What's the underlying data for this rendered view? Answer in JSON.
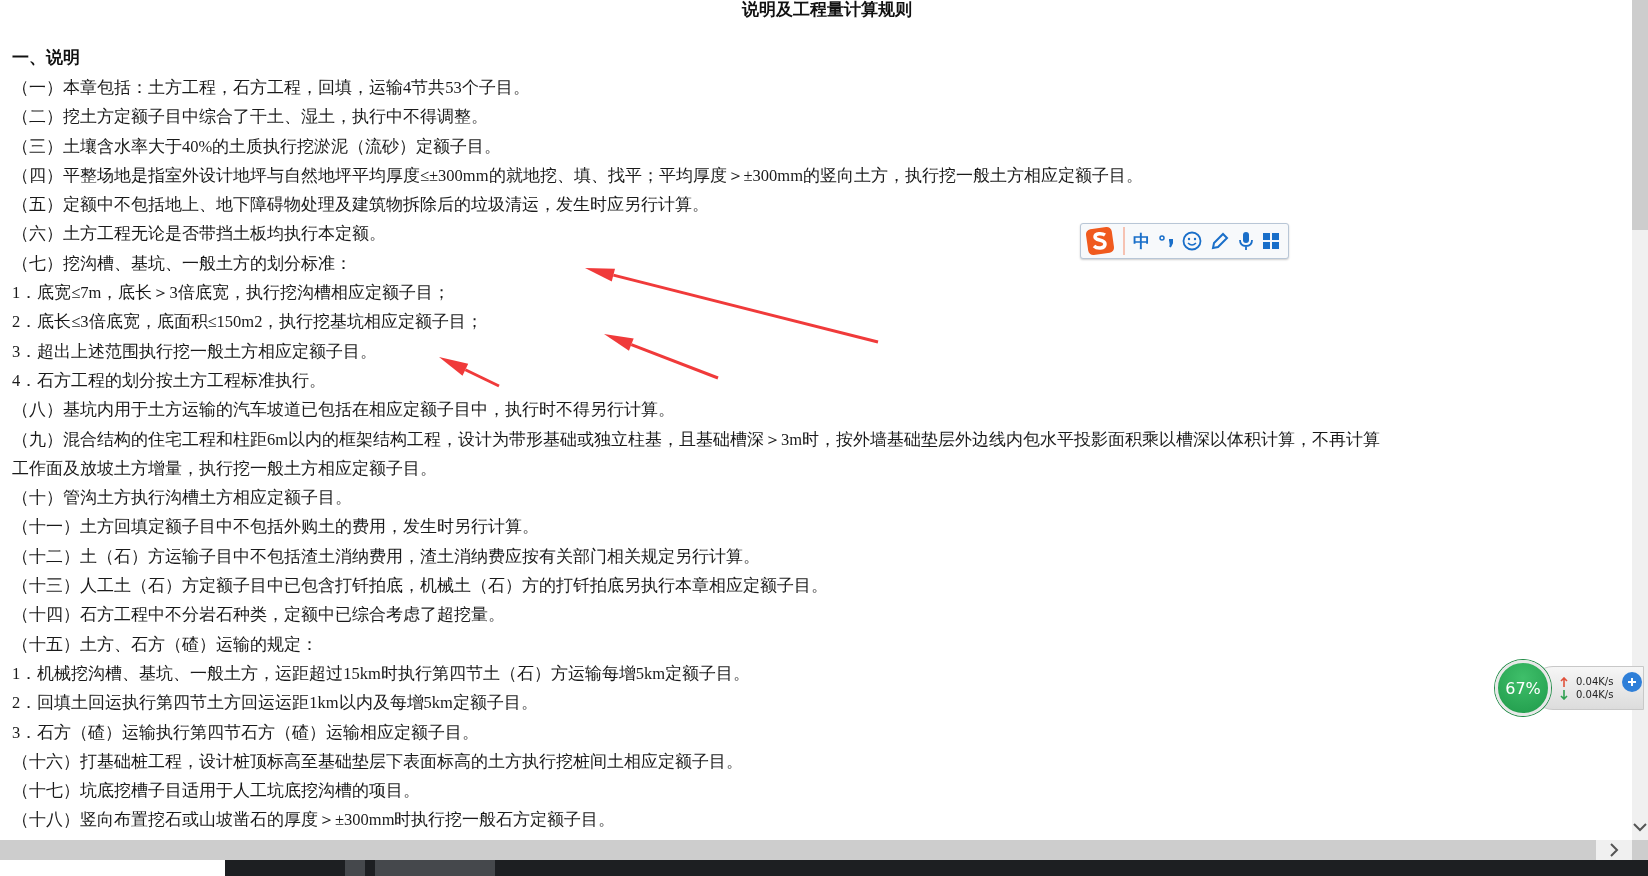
{
  "document": {
    "title": "说明及工程量计算规则",
    "heading": "一、说明",
    "lines": [
      {
        "text": "（一）本章包括：土方工程，石方工程，回填，运输4节共53个子目。"
      },
      {
        "text": "（二）挖土方定额子目中综合了干土、湿土，执行中不得调整。"
      },
      {
        "text": "（三）土壤含水率大于40%的土质执行挖淤泥（流砂）定额子目。"
      },
      {
        "text": "（四）平整场地是指室外设计地坪与自然地坪平均厚度≤±300mm的就地挖、填、找平；平均厚度＞±300mm的竖向土方，执行挖一般土方相应定额子目。"
      },
      {
        "text": "（五）定额中不包括地上、地下障碍物处理及建筑物拆除后的垃圾清运，发生时应另行计算。"
      },
      {
        "text": "（六）土方工程无论是否带挡土板均执行本定额。"
      },
      {
        "text": "（七）挖沟槽、基坑、一般土方的划分标准："
      },
      {
        "text": "1．底宽≤7m，底长＞3倍底宽，执行挖沟槽相应定额子目；"
      },
      {
        "text": "2．底长≤3倍底宽，底面积≤150m2，执行挖基坑相应定额子目；"
      },
      {
        "text": "3．超出上述范围执行挖一般土方相应定额子目。"
      },
      {
        "text": "4．石方工程的划分按土方工程标准执行。"
      },
      {
        "text": "（八）基坑内用于土方运输的汽车坡道已包括在相应定额子目中，执行时不得另行计算。"
      },
      {
        "text": "（九）混合结构的住宅工程和柱距6m以内的框架结构工程，设计为带形基础或独立柱基，且基础槽深＞3m时，按外墙基础垫层外边线内包水平投影面积乘以槽深以体积计算，不再计算工作面及放坡土方增量，执行挖一般土方相应定额子目。"
      },
      {
        "text": "（十）管沟土方执行沟槽土方相应定额子目。"
      },
      {
        "text": "（十一）土方回填定额子目中不包括外购土的费用，发生时另行计算。"
      },
      {
        "text": "（十二）土（石）方运输子目中不包括渣土消纳费用，渣土消纳费应按有关部门相关规定另行计算。"
      },
      {
        "text": "（十三）人工土（石）方定额子目中已包含打钎拍底，机械土（石）方的打钎拍底另执行本章相应定额子目。"
      },
      {
        "text": "（十四）石方工程中不分岩石种类，定额中已综合考虑了超挖量。"
      },
      {
        "text": "（十五）土方、石方（碴）运输的规定："
      },
      {
        "text": "1．机械挖沟槽、基坑、一般土方，运距超过15km时执行第四节土（石）方运输每增5km定额子目。"
      },
      {
        "text": "2．回填土回运执行第四节土方回运运距1km以内及每增5km定额子目。"
      },
      {
        "text": "3．石方（碴）运输执行第四节石方（碴）运输相应定额子目。"
      },
      {
        "text": "（十六）打基础桩工程，设计桩顶标高至基础垫层下表面标高的土方执行挖桩间土相应定额子目。"
      },
      {
        "text": "（十七）坑底挖槽子目适用于人工坑底挖沟槽的项目。"
      },
      {
        "text": "（十八）竖向布置挖石或山坡凿石的厚度＞±300mm时执行挖一般石方定额子目。"
      }
    ]
  },
  "ime_toolbar": {
    "mode": "中"
  },
  "network_widget": {
    "percent": "67%",
    "upload": "0.04K/s",
    "download": "0.04K/s"
  }
}
